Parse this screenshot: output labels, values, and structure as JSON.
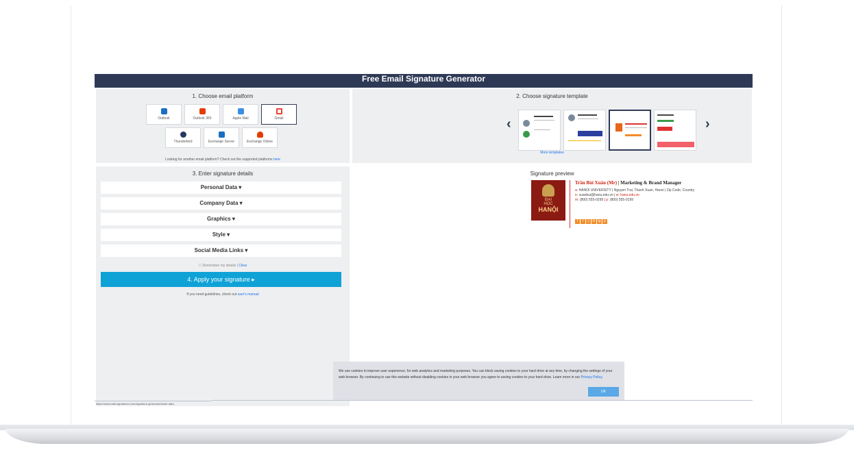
{
  "header": {
    "title": "Free Email Signature Generator"
  },
  "step1": {
    "title": "1. Choose email platform",
    "platforms": [
      {
        "label": "Outlook",
        "color": "#1b6fc2"
      },
      {
        "label": "Outlook 365",
        "color": "#e43c00"
      },
      {
        "label": "Apple Mail",
        "color": "#3a8ee6"
      },
      {
        "label": "Gmail",
        "color": "#ea4335",
        "selected": true
      },
      {
        "label": "Thunderbird",
        "color": "#263860"
      },
      {
        "label": "Exchange Server",
        "color": "#1b6fc2"
      },
      {
        "label": "Exchange Online",
        "color": "#e43c00"
      }
    ],
    "note_text": "Looking for another email platform? Check out the supported platforms ",
    "note_link": "here"
  },
  "step2": {
    "title": "2. Choose signature template",
    "more_link": "More templates",
    "prev_icon": "‹",
    "next_icon": "›"
  },
  "step3": {
    "title": "3. Enter signature details",
    "sections": [
      "Personal Data ▾",
      "Company Data ▾",
      "Graphics ▾",
      "Style ▾",
      "Social Media Links ▾"
    ],
    "remember_text": "☐ Remember my details | ",
    "remember_link": "Clear",
    "apply_label": "4. Apply your signature ▸",
    "guide_text": "If you need guidelines, check out ",
    "guide_link": "user's manual"
  },
  "preview": {
    "title": "Signature preview",
    "logo_lines": [
      "ĐẠI",
      "HỌC",
      "HANỘI"
    ],
    "name": "Trần Bùi Xuân (Mr)",
    "role": "| Marketing & Brand Manager",
    "line_a_label": "a:",
    "line_a": "HANOI UNIVERSITY | Nguyen Trai, Thanh Xuan, Hanoi | Zip Code, Country",
    "line_e_label": "e:",
    "line_e": "xuanbui@hanu.edu.vn",
    "line_w_sep": "|",
    "line_w_label": "w:",
    "line_w": "hanu.edu.vn",
    "line_m_label": "m:",
    "line_m": "(800) 555-0299",
    "line_p_sep": "|",
    "line_p_label": "p:",
    "line_p": "(800) 555-0199",
    "social": [
      "f",
      "t",
      "y",
      "in",
      "ig",
      "p"
    ]
  },
  "cookie": {
    "text": "We use cookies to improve user experience, for web analytics and marketing purposes. You can block saving cookies to your hard drive at any time, by changing the settings of your web browser. By continuing to use this website without disabling cookies in your web browser you agree to saving cookies to your hard drive. Learn more in our ",
    "link": "Privacy Policy",
    "ok": "OK"
  },
  "status": {
    "url": "https://www.mail-signatures.com/signature-generator/#user-data"
  }
}
